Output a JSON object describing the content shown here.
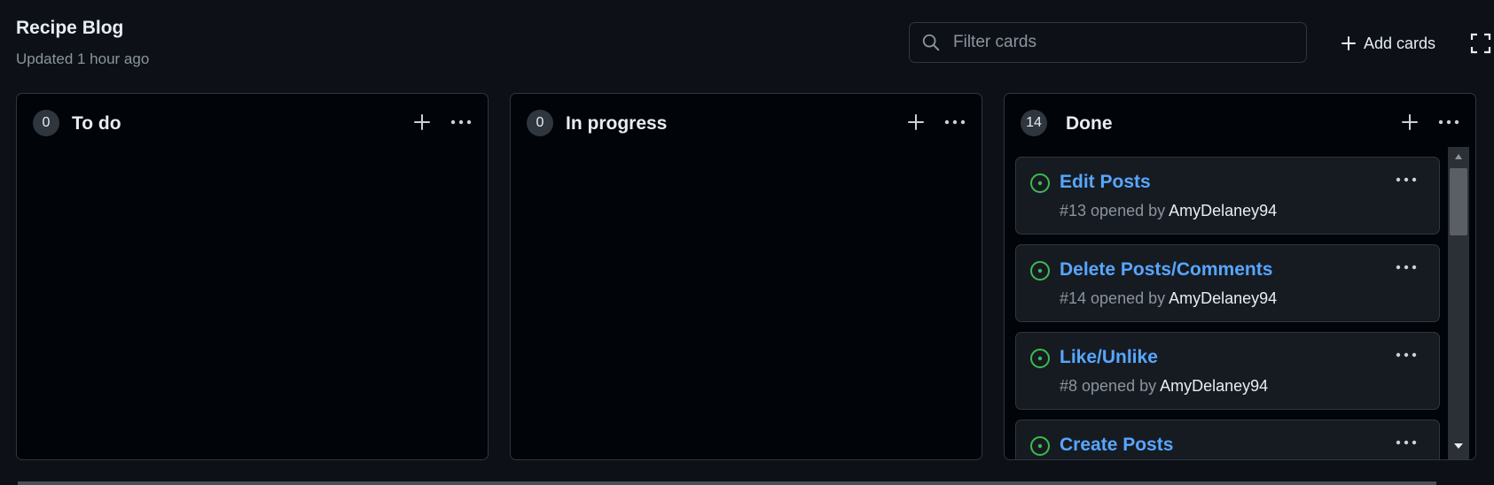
{
  "project": {
    "title": "Recipe Blog",
    "updated": "Updated 1 hour ago"
  },
  "toolbar": {
    "filter_placeholder": "Filter cards",
    "add_cards_label": "Add cards"
  },
  "columns": [
    {
      "name": "To do",
      "count": "0"
    },
    {
      "name": "In progress",
      "count": "0"
    },
    {
      "name": "Done",
      "count": "14",
      "cards": [
        {
          "title": "Edit Posts",
          "meta_prefix": "#13 opened by",
          "author": "AmyDelaney94"
        },
        {
          "title": "Delete Posts/Comments",
          "meta_prefix": "#14 opened by",
          "author": "AmyDelaney94"
        },
        {
          "title": "Like/Unlike",
          "meta_prefix": "#8 opened by",
          "author": "AmyDelaney94"
        },
        {
          "title": "Create Posts"
        }
      ]
    }
  ],
  "colors": {
    "background": "#0d1117",
    "column_bg": "#010409",
    "card_bg": "#161b22",
    "border": "#30363d",
    "link": "#58a6ff",
    "open_status": "#3fb950",
    "muted_text": "#8b949e"
  },
  "icons": {
    "search": "search-icon",
    "plus": "plus-icon",
    "fullscreen": "fullscreen-icon",
    "kebab": "kebab-horizontal-icon",
    "issue_open": "issue-opened-icon"
  }
}
